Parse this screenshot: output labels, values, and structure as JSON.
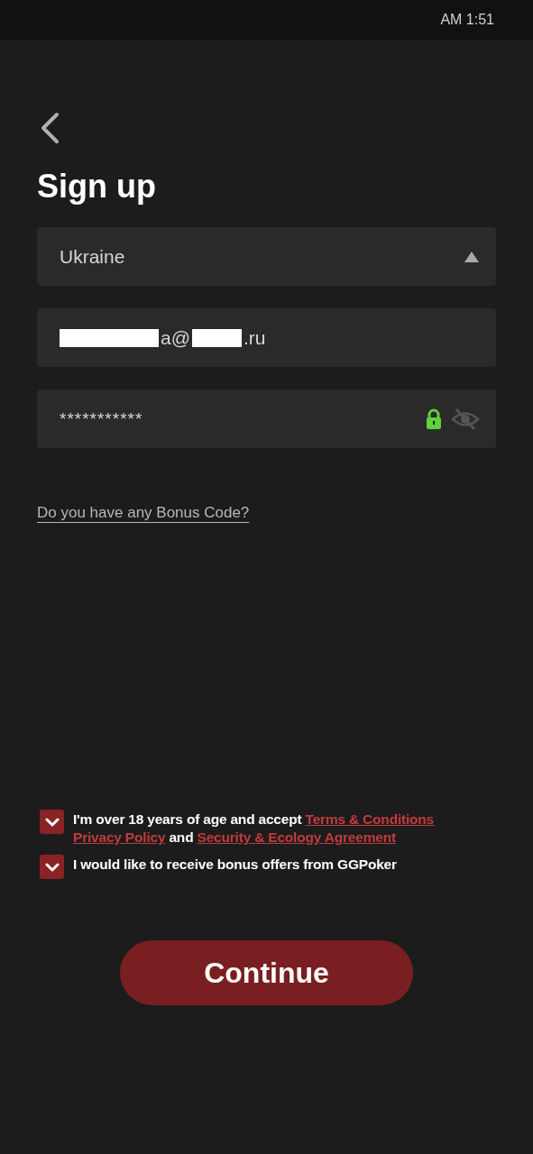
{
  "status_bar": {
    "time": "AM 1:51"
  },
  "title": "Sign up",
  "country": {
    "value": "Ukraine",
    "expanded": true
  },
  "email": {
    "parts": [
      {
        "kind": "redaction"
      },
      {
        "kind": "text",
        "text": "a@"
      },
      {
        "kind": "redaction"
      },
      {
        "kind": "text",
        "text": ".ru"
      }
    ]
  },
  "password": {
    "value": "***********",
    "secure": true,
    "visible": false
  },
  "bonus_link": "Do you have any Bonus Code?",
  "agreements": [
    {
      "checked": true,
      "segments": [
        {
          "kind": "text",
          "text": "I'm over 18 years of age and accept"
        },
        {
          "kind": "link",
          "text": "Terms & Conditions"
        },
        {
          "kind": "link",
          "text": "Privacy Policy"
        },
        {
          "kind": "text",
          "text": "and"
        },
        {
          "kind": "link",
          "text": "Security & Ecology Agreement"
        }
      ]
    },
    {
      "checked": true,
      "segments": [
        {
          "kind": "text",
          "text": "I would like to receive bonus offers from GGPoker"
        }
      ]
    }
  ],
  "continue_button": "Continue"
}
